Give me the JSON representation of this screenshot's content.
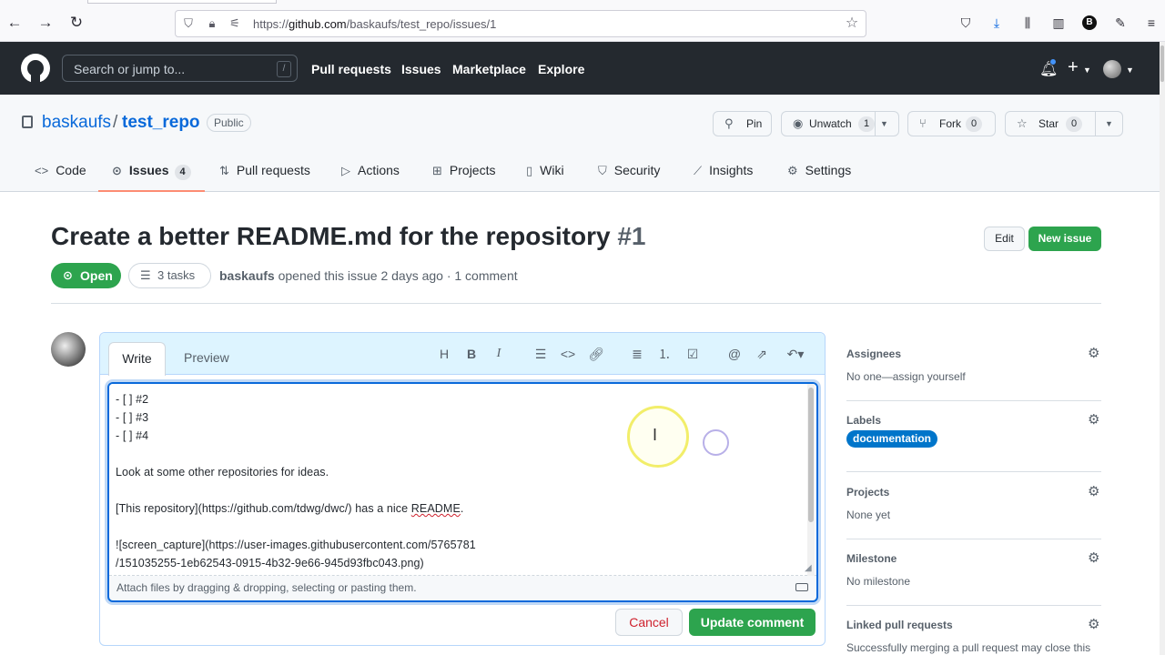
{
  "browser": {
    "url_prefix": "https://",
    "url_host": "github.com",
    "url_path": "/baskaufs/test_repo/issues/1",
    "profile_letter": "B"
  },
  "github": {
    "search_placeholder": "Search or jump to...",
    "search_shortcut": "/",
    "nav": [
      "Pull requests",
      "Issues",
      "Marketplace",
      "Explore"
    ],
    "plus": "+"
  },
  "repo": {
    "owner": "baskaufs",
    "separator": "/",
    "name": "test_repo",
    "visibility": "Public",
    "pin_label": "Pin",
    "unwatch_label": "Unwatch",
    "unwatch_count": "1",
    "fork_label": "Fork",
    "fork_count": "0",
    "star_label": "Star",
    "star_count": "0",
    "tabs": [
      {
        "label": "Code"
      },
      {
        "label": "Issues",
        "count": "4"
      },
      {
        "label": "Pull requests"
      },
      {
        "label": "Actions"
      },
      {
        "label": "Projects"
      },
      {
        "label": "Wiki"
      },
      {
        "label": "Security"
      },
      {
        "label": "Insights"
      },
      {
        "label": "Settings"
      }
    ]
  },
  "issue": {
    "title": "Create a better README.md for the repository",
    "number": "#1",
    "edit_label": "Edit",
    "new_issue_label": "New issue",
    "state": "Open",
    "tasks": "3 tasks",
    "author": "baskaufs",
    "meta": " opened this issue 2 days ago · 1 comment"
  },
  "editor": {
    "tab_write": "Write",
    "tab_preview": "Preview",
    "toolbar": {
      "heading": "H",
      "bold": "B",
      "italic": "I"
    },
    "lines": [
      "- [ ] #2",
      "- [ ] #3",
      "- [ ] #4",
      "",
      "Look at some other repositories for ideas.",
      "",
      "[This repository](https://github.com/tdwg/dwc/) has a nice README.",
      "",
      "![screen_capture](https://user-images.githubusercontent.com/5765781",
      "/151035255-1eb62543-0915-4b32-9e66-945d93fbc043.png)"
    ],
    "line7_prefix": "[This repository](https://github.com/tdwg/dwc/) has a nice ",
    "line7_misspelled": "README",
    "line7_suffix": ".",
    "attach_hint": "Attach files by dragging & dropping, selecting or pasting them.",
    "cancel_label": "Cancel",
    "update_label": "Update comment"
  },
  "sidebar": {
    "assignees": {
      "title": "Assignees",
      "value": "No one—assign yourself"
    },
    "labels": {
      "title": "Labels",
      "label": "documentation",
      "label_color": "#0075ca"
    },
    "projects": {
      "title": "Projects",
      "value": "None yet"
    },
    "milestone": {
      "title": "Milestone",
      "value": "No milestone"
    },
    "linked_prs": {
      "title": "Linked pull requests",
      "value": "Successfully merging a pull request may close this"
    }
  },
  "colors": {
    "header_bg": "#24292f",
    "primary_green": "#2da44e",
    "link_blue": "#0969da",
    "danger_red": "#cf222e",
    "active_tab_underline": "#fd8c73"
  }
}
